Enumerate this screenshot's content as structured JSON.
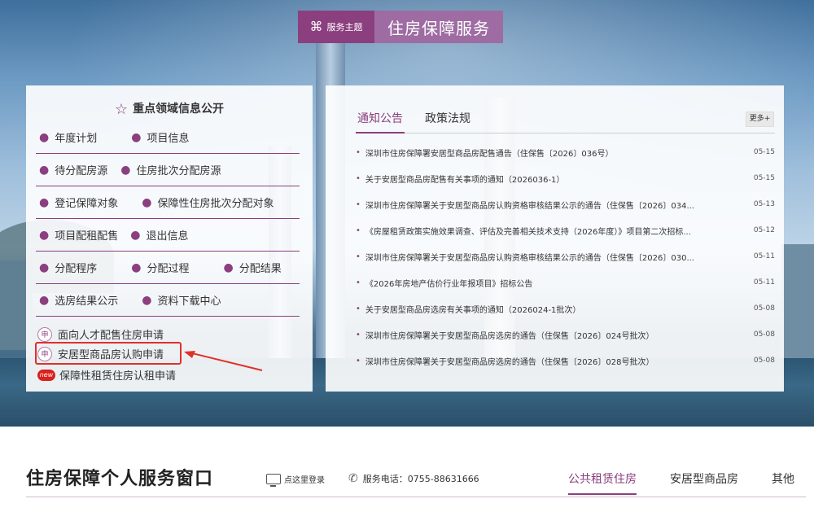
{
  "banner": {
    "tag_label": "服务主题",
    "tag_icon": "grid-icon",
    "title": "住房保障服务"
  },
  "left_panel": {
    "heading": "重点领域信息公开",
    "heading_icon": "star-icon",
    "rows": [
      [
        "年度计划",
        "项目信息"
      ],
      [
        "待分配房源",
        "住房批次分配房源"
      ],
      [
        "登记保障对象",
        "保障性住房批次分配对象"
      ],
      [
        "项目配租配售",
        "退出信息"
      ],
      [
        "分配程序",
        "分配过程",
        "分配结果"
      ],
      [
        "选房结果公示",
        "资料下载中心"
      ]
    ],
    "applications": [
      {
        "label": "面向人才配售住房申请",
        "icon": "申"
      },
      {
        "label": "安居型商品房认购申请",
        "icon": "申"
      },
      {
        "label": "保障性租赁住房认租申请",
        "icon": "new"
      }
    ]
  },
  "right_panel": {
    "tabs": [
      "通知公告",
      "政策法规"
    ],
    "more_label": "更多+",
    "news": [
      {
        "title": "深圳市住房保障署安居型商品房配售通告（住保售〔2026〕036号）",
        "date": "05-15"
      },
      {
        "title": "关于安居型商品房配售有关事项的通知（2026036-1）",
        "date": "05-15"
      },
      {
        "title": "深圳市住房保障署关于安居型商品房认购资格审核结果公示的通告（住保售〔2026〕034...",
        "date": "05-13"
      },
      {
        "title": "《房屋租赁政策实施效果调查、评估及完善相关技术支持（2026年度）》项目第二次招标...",
        "date": "05-12"
      },
      {
        "title": "深圳市住房保障署关于安居型商品房认购资格审核结果公示的通告（住保售〔2026〕030...",
        "date": "05-11"
      },
      {
        "title": "《2026年房地产估价行业年报项目》招标公告",
        "date": "05-11"
      },
      {
        "title": "关于安居型商品房选房有关事项的通知（2026024-1批次）",
        "date": "05-08"
      },
      {
        "title": "深圳市住房保障署关于安居型商品房选房的通告（住保售〔2026〕024号批次）",
        "date": "05-08"
      },
      {
        "title": "深圳市住房保障署关于安居型商品房选房的通告（住保售〔2026〕028号批次）",
        "date": "05-08"
      }
    ]
  },
  "bottom": {
    "title": "住房保障个人服务窗口",
    "login_label": "点这里登录",
    "hotline": "服务电话：0755-88631666",
    "tabs": [
      "公共租赁住房",
      "安居型商品房",
      "其他"
    ]
  },
  "colors": {
    "accent": "#8b3f7e",
    "banner_title_bg": "#9e6ca2",
    "highlight": "#e0302a"
  }
}
